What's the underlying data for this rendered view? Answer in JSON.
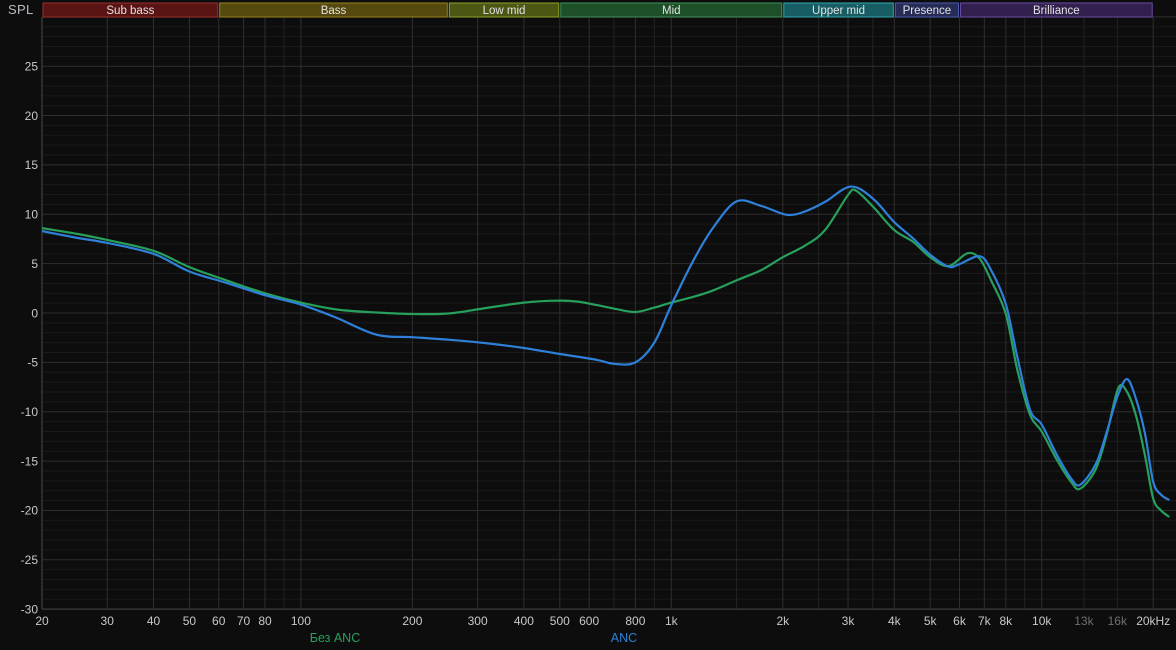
{
  "header": {
    "spl_label": "SPL"
  },
  "colors": {
    "background": "#0d0d0d",
    "grid_minor": "#1a1a1a",
    "grid_mid": "#232323",
    "grid_major": "#2f2f2f",
    "axis_line": "#4a4a4a",
    "tick_label": "#c9c9c9",
    "tick_label_dim": "#6f6f6f",
    "band_label": "#e2e2e2",
    "spl_label": "#b7bdc3"
  },
  "bands": [
    {
      "label": "Sub bass",
      "f_start": 20,
      "f_end": 60,
      "fill": "#5a1414",
      "edge": "#9b2f2f"
    },
    {
      "label": "Bass",
      "f_start": 60,
      "f_end": 250,
      "fill": "#554910",
      "edge": "#96851f"
    },
    {
      "label": "Low mid",
      "f_start": 250,
      "f_end": 500,
      "fill": "#4c5714",
      "edge": "#8ba32a"
    },
    {
      "label": "Mid",
      "f_start": 500,
      "f_end": 2000,
      "fill": "#1d4f29",
      "edge": "#3d9456"
    },
    {
      "label": "Upper mid",
      "f_start": 2000,
      "f_end": 4000,
      "fill": "#185d63",
      "edge": "#2fa7b0"
    },
    {
      "label": "Presence",
      "f_start": 4000,
      "f_end": 6000,
      "fill": "#262c55",
      "edge": "#4d5bb0"
    },
    {
      "label": "Brilliance",
      "f_start": 6000,
      "f_end": 20000,
      "fill": "#32214e",
      "edge": "#6a4aa8"
    }
  ],
  "axes": {
    "y": {
      "tick_labels": [
        25,
        20,
        15,
        10,
        5,
        0,
        -5,
        -10,
        -15,
        -20,
        -25,
        -30
      ],
      "db_min": -30,
      "db_max": 30,
      "major_step_db": 5,
      "minor_step_db": 1
    },
    "x": {
      "ticks": [
        {
          "f": 20,
          "label": "20"
        },
        {
          "f": 30,
          "label": "30"
        },
        {
          "f": 40,
          "label": "40"
        },
        {
          "f": 50,
          "label": "50"
        },
        {
          "f": 60,
          "label": "60"
        },
        {
          "f": 70,
          "label": "70"
        },
        {
          "f": 80,
          "label": "80"
        },
        {
          "f": 100,
          "label": "100"
        },
        {
          "f": 200,
          "label": "200"
        },
        {
          "f": 300,
          "label": "300"
        },
        {
          "f": 400,
          "label": "400"
        },
        {
          "f": 500,
          "label": "500"
        },
        {
          "f": 600,
          "label": "600"
        },
        {
          "f": 800,
          "label": "800"
        },
        {
          "f": 1000,
          "label": "1k"
        },
        {
          "f": 2000,
          "label": "2k"
        },
        {
          "f": 3000,
          "label": "3k"
        },
        {
          "f": 4000,
          "label": "4k"
        },
        {
          "f": 5000,
          "label": "5k"
        },
        {
          "f": 6000,
          "label": "6k"
        },
        {
          "f": 7000,
          "label": "7k"
        },
        {
          "f": 8000,
          "label": "8k"
        },
        {
          "f": 10000,
          "label": "10k"
        },
        {
          "f": 13000,
          "label": "13k",
          "dim": true
        },
        {
          "f": 16000,
          "label": "16k",
          "dim": true
        },
        {
          "f": 20000,
          "label": "20kHz"
        }
      ],
      "minor_f": [
        90,
        700,
        900,
        1500,
        2500,
        3500,
        9000
      ]
    }
  },
  "legend": [
    {
      "id": "no-anc",
      "label": "Без ANC",
      "color": "#27a05c"
    },
    {
      "id": "anc",
      "label": "ANC",
      "color": "#2e80d8"
    }
  ],
  "chart_data": {
    "type": "line",
    "x_scale": "log",
    "xlim": [
      20,
      23000
    ],
    "ylim": [
      -30,
      30
    ],
    "x_unit": "Hz",
    "y_unit": "dB SPL",
    "grid": true,
    "legend_position": "bottom",
    "series": [
      {
        "name": "Без ANC",
        "id": "no-anc",
        "color": "#27a05c",
        "points": [
          [
            20,
            8.6
          ],
          [
            25,
            8.0
          ],
          [
            30,
            7.4
          ],
          [
            40,
            6.3
          ],
          [
            50,
            4.65
          ],
          [
            63,
            3.3
          ],
          [
            80,
            2.0
          ],
          [
            100,
            1.05
          ],
          [
            125,
            0.35
          ],
          [
            160,
            0.05
          ],
          [
            200,
            -0.1
          ],
          [
            250,
            -0.05
          ],
          [
            315,
            0.5
          ],
          [
            400,
            1.05
          ],
          [
            490,
            1.25
          ],
          [
            560,
            1.15
          ],
          [
            630,
            0.8
          ],
          [
            700,
            0.45
          ],
          [
            800,
            0.1
          ],
          [
            900,
            0.55
          ],
          [
            1000,
            1.05
          ],
          [
            1150,
            1.65
          ],
          [
            1300,
            2.3
          ],
          [
            1500,
            3.3
          ],
          [
            1750,
            4.35
          ],
          [
            2000,
            5.65
          ],
          [
            2300,
            6.85
          ],
          [
            2600,
            8.4
          ],
          [
            3000,
            11.95
          ],
          [
            3150,
            12.4
          ],
          [
            3500,
            10.8
          ],
          [
            4000,
            8.4
          ],
          [
            4500,
            7.2
          ],
          [
            5000,
            5.65
          ],
          [
            5600,
            4.75
          ],
          [
            6300,
            6.05
          ],
          [
            6800,
            5.5
          ],
          [
            7300,
            3.3
          ],
          [
            8000,
            -0.1
          ],
          [
            8600,
            -5.8
          ],
          [
            9300,
            -10.3
          ],
          [
            10000,
            -12.0
          ],
          [
            11000,
            -14.9
          ],
          [
            12000,
            -17.1
          ],
          [
            12700,
            -17.8
          ],
          [
            14000,
            -15.8
          ],
          [
            15000,
            -12.2
          ],
          [
            16100,
            -7.6
          ],
          [
            17000,
            -8.0
          ],
          [
            18000,
            -10.5
          ],
          [
            19000,
            -14.4
          ],
          [
            20000,
            -18.8
          ],
          [
            21000,
            -20.0
          ],
          [
            22000,
            -20.6
          ]
        ]
      },
      {
        "name": "ANC",
        "id": "anc",
        "color": "#2e80d8",
        "points": [
          [
            20,
            8.3
          ],
          [
            25,
            7.6
          ],
          [
            30,
            7.1
          ],
          [
            40,
            6.0
          ],
          [
            50,
            4.2
          ],
          [
            63,
            3.05
          ],
          [
            80,
            1.8
          ],
          [
            100,
            0.85
          ],
          [
            125,
            -0.5
          ],
          [
            160,
            -2.2
          ],
          [
            200,
            -2.45
          ],
          [
            250,
            -2.7
          ],
          [
            315,
            -3.05
          ],
          [
            400,
            -3.55
          ],
          [
            500,
            -4.15
          ],
          [
            630,
            -4.75
          ],
          [
            700,
            -5.15
          ],
          [
            800,
            -5.0
          ],
          [
            900,
            -3.0
          ],
          [
            1000,
            0.8
          ],
          [
            1150,
            5.4
          ],
          [
            1300,
            8.7
          ],
          [
            1500,
            11.3
          ],
          [
            1750,
            10.85
          ],
          [
            2050,
            9.95
          ],
          [
            2300,
            10.3
          ],
          [
            2600,
            11.25
          ],
          [
            3050,
            12.8
          ],
          [
            3500,
            11.6
          ],
          [
            4000,
            9.2
          ],
          [
            4500,
            7.55
          ],
          [
            5000,
            5.9
          ],
          [
            5600,
            4.7
          ],
          [
            6000,
            4.95
          ],
          [
            6800,
            5.75
          ],
          [
            7300,
            4.35
          ],
          [
            8000,
            0.9
          ],
          [
            8600,
            -4.5
          ],
          [
            9300,
            -9.8
          ],
          [
            10000,
            -11.3
          ],
          [
            11000,
            -14.4
          ],
          [
            12000,
            -16.75
          ],
          [
            12700,
            -17.4
          ],
          [
            14000,
            -15.3
          ],
          [
            15000,
            -12.0
          ],
          [
            16000,
            -8.5
          ],
          [
            17000,
            -6.7
          ],
          [
            18000,
            -8.8
          ],
          [
            19000,
            -12.2
          ],
          [
            20000,
            -17.1
          ],
          [
            21000,
            -18.4
          ],
          [
            22000,
            -18.9
          ]
        ]
      }
    ]
  }
}
